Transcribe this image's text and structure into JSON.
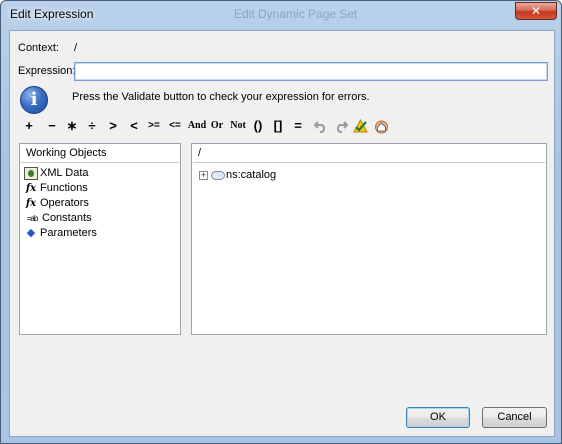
{
  "window": {
    "title": "Edit Expression",
    "background_title": "Edit Dynamic Page Set",
    "close_glyph": "✕"
  },
  "context": {
    "label": "Context:",
    "value": "/"
  },
  "expression": {
    "label": "Expression:",
    "value": ""
  },
  "info": {
    "icon_glyph": "i",
    "message": "Press the Validate button to check your expression for errors."
  },
  "toolbar": {
    "items": [
      "+",
      "−",
      "∗",
      "÷",
      ">",
      "<",
      ">=",
      "<=",
      "And",
      "Or",
      "Not",
      "()",
      "[]",
      "="
    ],
    "undo_icon": "undo-icon",
    "redo_icon": "redo-icon",
    "validate_icon": "validate-icon",
    "home_icon": "home-icon"
  },
  "working_objects": {
    "header": "Working Objects",
    "items": [
      "XML Data",
      "Functions",
      "Operators",
      "Constants",
      "Parameters"
    ]
  },
  "tree": {
    "header": "/",
    "node": "ns:catalog",
    "expander": "+"
  },
  "buttons": {
    "ok": "OK",
    "cancel": "Cancel"
  },
  "colors": {
    "title_gradient_top": "#b9d1ea",
    "close_red": "#c0391e",
    "client_bg": "#f0f0f0",
    "input_border": "#7a9cd3"
  }
}
